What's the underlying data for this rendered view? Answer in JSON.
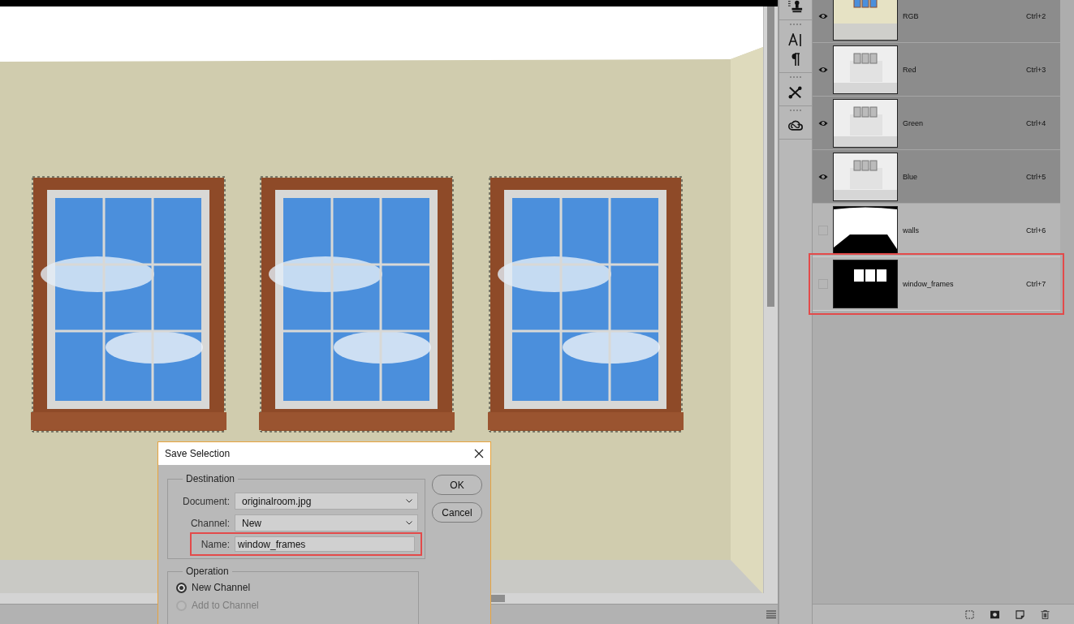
{
  "dialog": {
    "title": "Save Selection",
    "destination": {
      "legend": "Destination",
      "document": {
        "label": "Document:",
        "value": "originalroom.jpg"
      },
      "channel": {
        "label": "Channel:",
        "value": "New"
      },
      "name": {
        "label": "Name:",
        "value": "window_frames",
        "highlighted": true
      }
    },
    "operation": {
      "legend": "Operation",
      "options": [
        {
          "label": "New Channel",
          "selected": true,
          "disabled": false
        },
        {
          "label": "Add to Channel",
          "selected": false,
          "disabled": true
        }
      ]
    },
    "buttons": [
      "OK",
      "Cancel"
    ]
  },
  "channels": [
    {
      "name": "RGB",
      "shortcut": "Ctrl+2",
      "visible": true,
      "selected": true,
      "kind": "color",
      "highlighted": false
    },
    {
      "name": "Red",
      "shortcut": "Ctrl+3",
      "visible": true,
      "selected": true,
      "kind": "gray",
      "highlighted": false
    },
    {
      "name": "Green",
      "shortcut": "Ctrl+4",
      "visible": true,
      "selected": true,
      "kind": "gray",
      "highlighted": false
    },
    {
      "name": "Blue",
      "shortcut": "Ctrl+5",
      "visible": true,
      "selected": true,
      "kind": "gray",
      "highlighted": false
    },
    {
      "name": "walls",
      "shortcut": "Ctrl+6",
      "visible": false,
      "selected": false,
      "kind": "walls-mask",
      "highlighted": false
    },
    {
      "name": "window_frames",
      "shortcut": "Ctrl+7",
      "visible": false,
      "selected": false,
      "kind": "windows-mask",
      "highlighted": true
    }
  ]
}
